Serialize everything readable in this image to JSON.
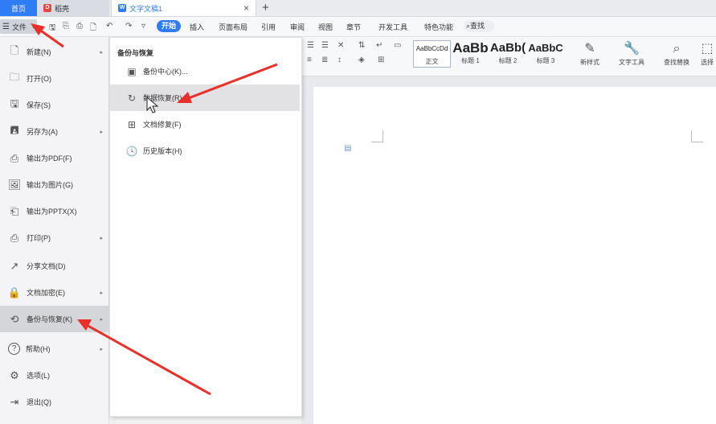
{
  "tabs": {
    "home": "首页",
    "daoke": "稻壳",
    "doc": "文字文稿1",
    "close": "×",
    "new": "+"
  },
  "menubar": {
    "file": "文件",
    "tabs": [
      "开始",
      "插入",
      "页面布局",
      "引用",
      "审阅",
      "视图",
      "章节",
      "开发工具",
      "特色功能"
    ],
    "search": "查找"
  },
  "styles": [
    {
      "preview": "AaBbCcDd",
      "label": "正文"
    },
    {
      "preview": "AaBb",
      "label": "标题 1"
    },
    {
      "preview": "AaBb(",
      "label": "标题 2"
    },
    {
      "preview": "AaBbC",
      "label": "标题 3"
    }
  ],
  "ribbon_tools": {
    "new_style": "新样式",
    "text_tools": "文字工具",
    "find_replace": "查找替换",
    "select": "选择"
  },
  "file_menu": [
    {
      "label": "新建(N)",
      "icon": "new-doc-icon",
      "arrow": true
    },
    {
      "label": "打开(O)",
      "icon": "folder-icon",
      "arrow": false
    },
    {
      "label": "保存(S)",
      "icon": "save-icon",
      "arrow": false
    },
    {
      "label": "另存为(A)",
      "icon": "save-as-icon",
      "arrow": true
    },
    {
      "label": "输出为PDF(F)",
      "icon": "pdf-icon",
      "arrow": false
    },
    {
      "label": "输出为图片(G)",
      "icon": "image-icon",
      "arrow": false
    },
    {
      "label": "输出为PPTX(X)",
      "icon": "pptx-icon",
      "arrow": false
    },
    {
      "label": "打印(P)",
      "icon": "printer-icon",
      "arrow": true
    },
    {
      "label": "分享文档(D)",
      "icon": "share-icon",
      "arrow": false
    },
    {
      "label": "文档加密(E)",
      "icon": "lock-doc-icon",
      "arrow": true
    },
    {
      "label": "备份与恢复(K)",
      "icon": "backup-icon",
      "arrow": true
    },
    {
      "label": "帮助(H)",
      "icon": "help-icon",
      "arrow": true
    },
    {
      "label": "选项(L)",
      "icon": "gear-icon",
      "arrow": false
    },
    {
      "label": "退出(Q)",
      "icon": "exit-icon",
      "arrow": false
    }
  ],
  "submenu": {
    "title": "备份与恢复",
    "items": [
      {
        "label": "备份中心(K)...",
        "icon": "backup-center-icon"
      },
      {
        "label": "数据恢复(R)",
        "icon": "data-recovery-icon"
      },
      {
        "label": "文档修复(F)",
        "icon": "doc-repair-icon"
      },
      {
        "label": "历史版本(H)",
        "icon": "history-icon"
      }
    ]
  },
  "colors": {
    "accent": "#2f7cf6",
    "arrow": "#e8302a"
  }
}
